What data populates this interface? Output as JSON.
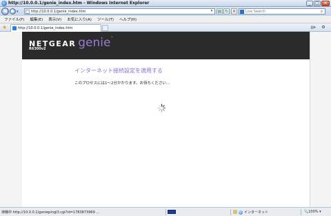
{
  "window": {
    "title": "http://10.0.0.1/genie_index.htm - Windows Internet Explorer",
    "minimize": "_",
    "maximize": "□",
    "close": "✕"
  },
  "address_bar": {
    "url": "http://10.0.0.1/genie_index.htm"
  },
  "search": {
    "placeholder": "Live Search"
  },
  "menu": {
    "items": [
      "ファイル(F)",
      "編集(E)",
      "表示(V)",
      "お気に入り(A)",
      "ツール(T)",
      "ヘルプ(H)"
    ]
  },
  "tab": {
    "label": "http://10.0.0.1/genie_index.htm"
  },
  "page": {
    "brand_netgear": "NETGEAR",
    "brand_genie": "genie",
    "trademark": "™",
    "model": "R6300v2",
    "heading": "インターネット接続設定を適用する",
    "subtext": "このプロセスには1～2分かかります。お待ちください..."
  },
  "status_bar": {
    "text": "待機中 http://10.0.0.1/geniepingl3.cgi?id=1783873969 ...",
    "zone": "インターネット",
    "zoom": "100%"
  },
  "colors": {
    "accent_purple": "#8e71cb",
    "header_bg": "#2b2b2b"
  }
}
